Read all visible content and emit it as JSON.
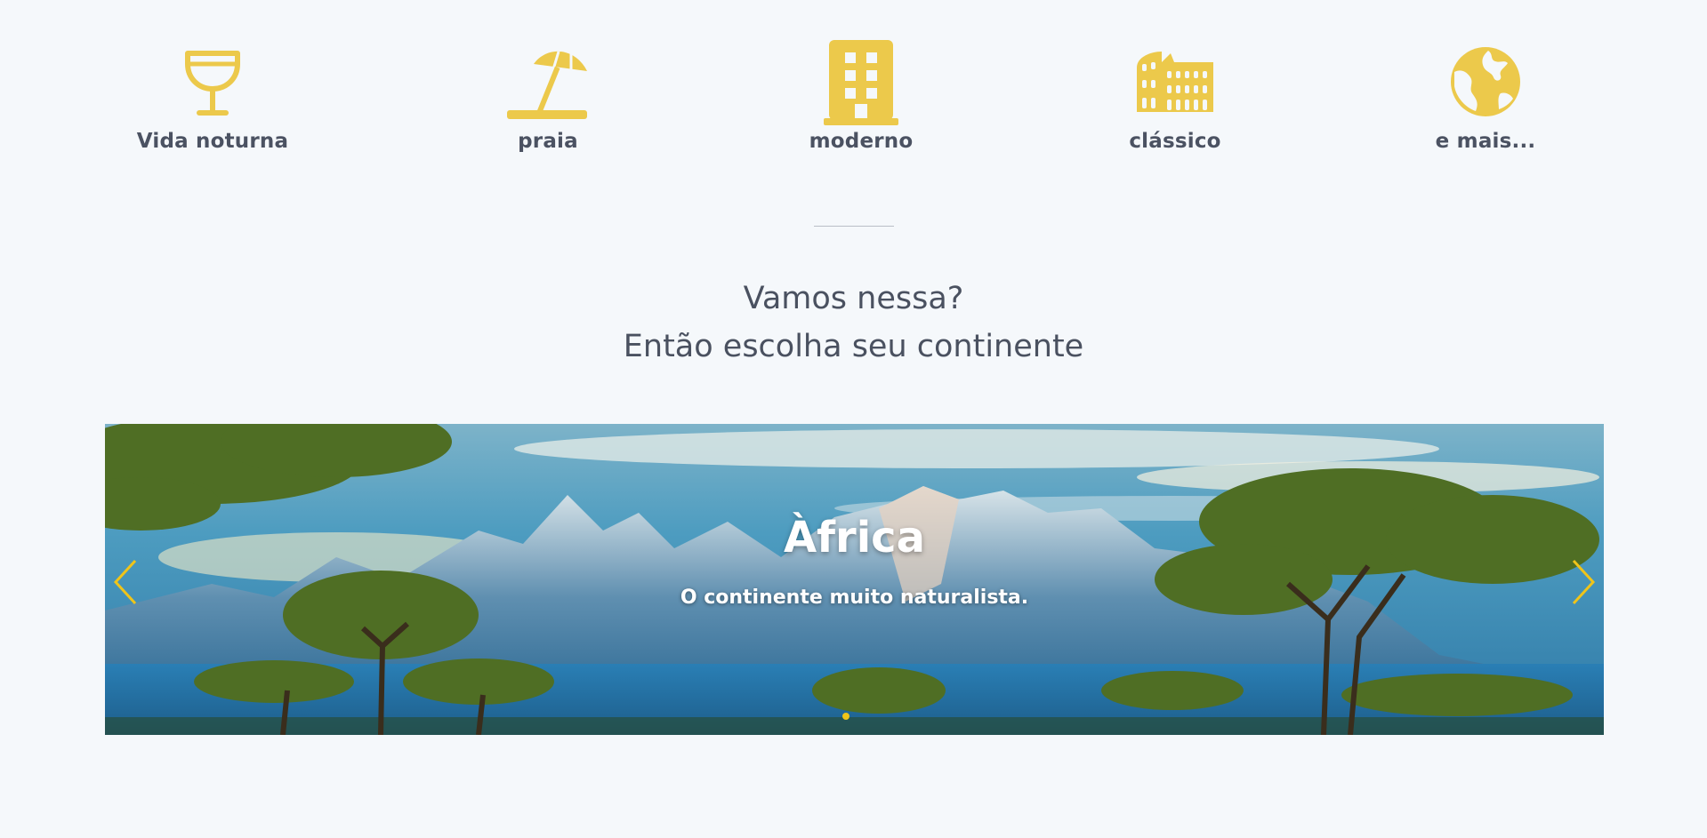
{
  "accent_color": "#ecc94b",
  "categories": [
    {
      "icon": "wine-glass-icon",
      "label": "Vida noturna"
    },
    {
      "icon": "umbrella-beach-icon",
      "label": "praia"
    },
    {
      "icon": "building-icon",
      "label": "moderno"
    },
    {
      "icon": "colosseum-icon",
      "label": "clássico"
    },
    {
      "icon": "globe-icon",
      "label": "e mais..."
    }
  ],
  "heading": {
    "line1": "Vamos nessa?",
    "line2": "Então escolha seu continente"
  },
  "carousel": {
    "slide_title": "Àfrica",
    "slide_subtitle": "O continente muito naturalista.",
    "prev_icon": "chevron-left-icon",
    "next_icon": "chevron-right-icon",
    "indicator_count": 1,
    "active_indicator": 1
  }
}
